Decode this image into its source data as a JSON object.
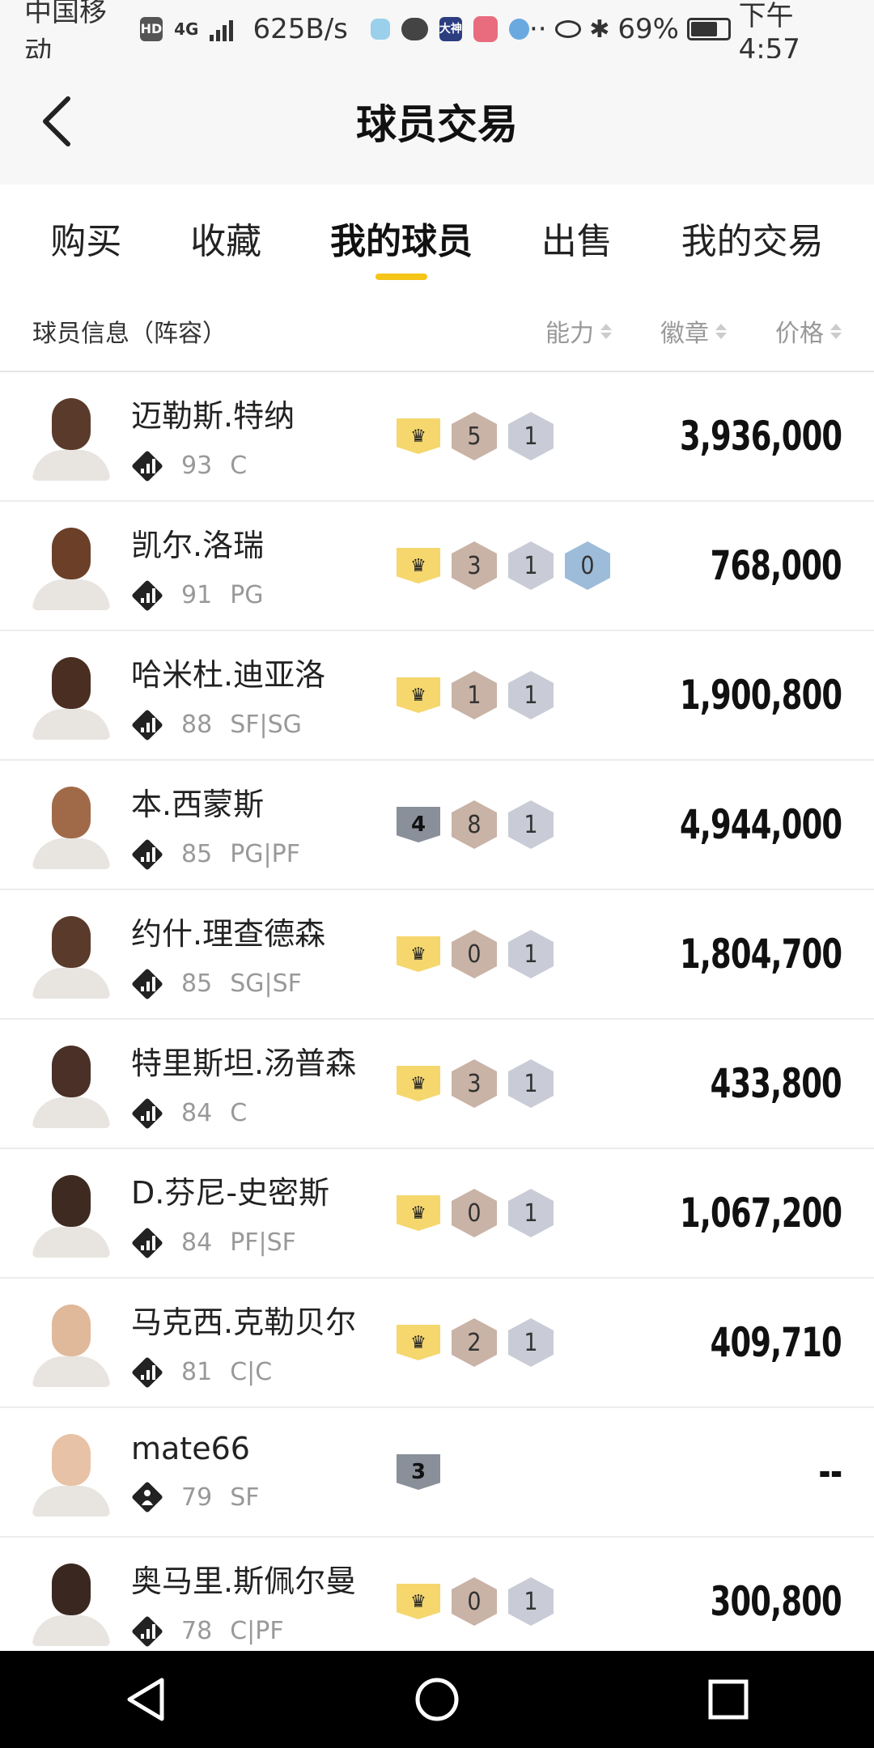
{
  "statusbar": {
    "carrier": "中国移动",
    "hd_badge": "HD",
    "network": "4G",
    "speed": "625B/s",
    "app_badge": "大神",
    "battery_percent": "69%",
    "battery_level": 0.69,
    "time": "下午4:57"
  },
  "header": {
    "title": "球员交易"
  },
  "tabs": [
    {
      "label": "购买",
      "active": false
    },
    {
      "label": "收藏",
      "active": false
    },
    {
      "label": "我的球员",
      "active": true
    },
    {
      "label": "出售",
      "active": false
    },
    {
      "label": "我的交易",
      "active": false
    }
  ],
  "columns": {
    "info": "球员信息（阵容）",
    "ability": "能力",
    "badge": "徽章",
    "price": "价格"
  },
  "players": [
    {
      "name": "迈勒斯.特纳",
      "rating": "93",
      "position": "C",
      "tier": "crown",
      "tier_text": "",
      "badge_bronze": "5",
      "badge_silver": "1",
      "badge_blue": "",
      "price": "3,936,000",
      "skin": "#5a3a2a"
    },
    {
      "name": "凯尔.洛瑞",
      "rating": "91",
      "position": "PG",
      "tier": "crown",
      "tier_text": "",
      "badge_bronze": "3",
      "badge_silver": "1",
      "badge_blue": "0",
      "price": "768,000",
      "skin": "#6b3f28"
    },
    {
      "name": "哈米杜.迪亚洛",
      "rating": "88",
      "position": "SF|SG",
      "tier": "crown",
      "tier_text": "",
      "badge_bronze": "1",
      "badge_silver": "1",
      "badge_blue": "",
      "price": "1,900,800",
      "skin": "#4a2e22"
    },
    {
      "name": "本.西蒙斯",
      "rating": "85",
      "position": "PG|PF",
      "tier": "shield",
      "tier_text": "4",
      "badge_bronze": "8",
      "badge_silver": "1",
      "badge_blue": "",
      "price": "4,944,000",
      "skin": "#a06a48"
    },
    {
      "name": "约什.理查德森",
      "rating": "85",
      "position": "SG|SF",
      "tier": "crown",
      "tier_text": "",
      "badge_bronze": "0",
      "badge_silver": "1",
      "badge_blue": "",
      "price": "1,804,700",
      "skin": "#5a3a2a"
    },
    {
      "name": "特里斯坦.汤普森",
      "rating": "84",
      "position": "C",
      "tier": "crown",
      "tier_text": "",
      "badge_bronze": "3",
      "badge_silver": "1",
      "badge_blue": "",
      "price": "433,800",
      "skin": "#4a3026"
    },
    {
      "name": "D.芬尼-史密斯",
      "rating": "84",
      "position": "PF|SF",
      "tier": "crown",
      "tier_text": "",
      "badge_bronze": "0",
      "badge_silver": "1",
      "badge_blue": "",
      "price": "1,067,200",
      "skin": "#3e2a20"
    },
    {
      "name": "马克西.克勒贝尔",
      "rating": "81",
      "position": "C|C",
      "tier": "crown",
      "tier_text": "",
      "badge_bronze": "2",
      "badge_silver": "1",
      "badge_blue": "",
      "price": "409,710",
      "skin": "#e0b89a"
    },
    {
      "name": "mate66",
      "rating": "79",
      "position": "SF",
      "tier": "shield",
      "tier_text": "3",
      "badge_bronze": "",
      "badge_silver": "",
      "badge_blue": "",
      "price": "--",
      "skin": "#e8c2a6",
      "type": "person"
    },
    {
      "name": "奥马里.斯佩尔曼",
      "rating": "78",
      "position": "C|PF",
      "tier": "crown",
      "tier_text": "",
      "badge_bronze": "0",
      "badge_silver": "1",
      "badge_blue": "",
      "price": "300,800",
      "skin": "#3a2820"
    }
  ],
  "colors": {
    "accent": "#f5c518",
    "crown": "#f5d76e",
    "bronze_badge": "#c9b3a6",
    "silver_badge": "#c9ccd6",
    "blue_badge": "#9dbcd9"
  },
  "icons": {
    "back": "chevron-left-icon",
    "crown": "crown-icon",
    "nav_back": "triangle-back-icon",
    "nav_home": "circle-home-icon",
    "nav_recent": "square-recents-icon"
  }
}
